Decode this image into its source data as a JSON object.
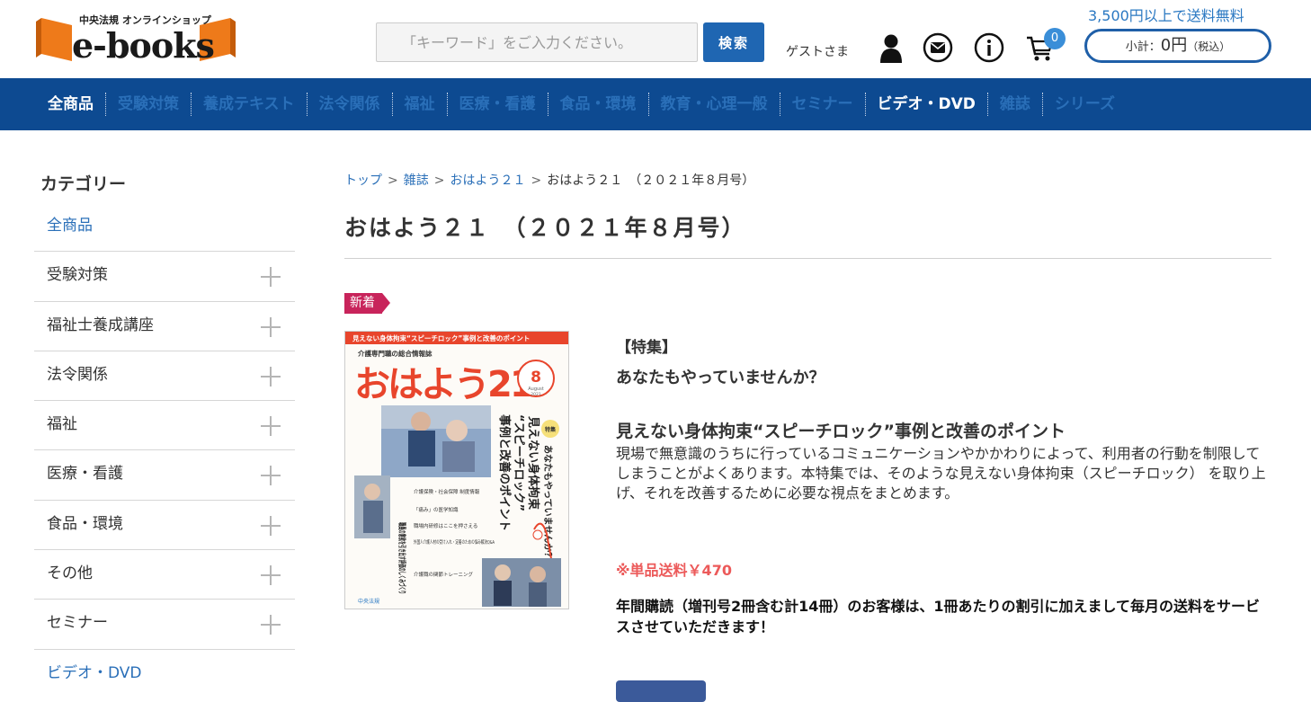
{
  "header": {
    "logo_sub": "中央法規 オンラインショップ",
    "logo_main": "e-books",
    "search_placeholder": "「キーワード」をご入力ください。",
    "search_button": "検索",
    "guest": "ゲストさま",
    "cart_count": "0",
    "free_shipping": "3,500円以上で送料無料",
    "subtotal_label": "小計：",
    "subtotal_amount": "0円",
    "subtotal_tax": "（税込）"
  },
  "nav": {
    "items": [
      "全商品",
      "受験対策",
      "養成テキスト",
      "法令関係",
      "福祉",
      "医療・看護",
      "食品・環境",
      "教育・心理一般",
      "セミナー",
      "ビデオ・DVD",
      "雑誌",
      "シリーズ"
    ]
  },
  "sidebar": {
    "title": "カテゴリー",
    "items": [
      "全商品",
      "受験対策",
      "福祉士養成講座",
      "法令関係",
      "福祉",
      "医療・看護",
      "食品・環境",
      "その他",
      "セミナー",
      "ビデオ・DVD"
    ]
  },
  "breadcrumb": [
    "トップ",
    "雑誌",
    "おはよう２１",
    "おはよう２１　（２０２１年８月号）"
  ],
  "product": {
    "title": "おはよう２１　（２０２１年８月号）",
    "new_tag": "新着",
    "feature_tag": "【特集】",
    "lead": "あなたもやっていませんか？",
    "headline": "見えない身体拘束“スピーチロック”事例と改善のポイント",
    "body": "現場で無意識のうちに行っているコミュニケーションやかかわりによって、利用者の行動を制限してしまうことがよくあります。本特集では、そのような見えない身体拘束（スピーチロック） を取り上げ、それを改善するために必要な視点をまとめます。",
    "shipping": "※単品送料￥470",
    "subscription": "年間購読（増刊号2冊含む計14冊）のお客様は、1冊あたりの割引に加えまして毎月の送料をサービスさせていただきます！"
  },
  "cover": {
    "top_banner": "見えない身体拘束“スピーチロック”事例と改善のポイント",
    "magazine_sub": "介護専門職の総合情報誌",
    "magazine_name": "おはよう21",
    "issue_number": "8",
    "issue_month": "August",
    "issue_year": "2021",
    "feature_badge": "特集",
    "question": "あなたもやっていませんか？",
    "headline_line1": "見えない身体拘束",
    "headline_line2": "“スピーチロック”",
    "headline_line3": "事例と改善のポイント",
    "side_text_1": "職員の意欲を引き出す評価のしくみづくり",
    "side_text_2": "介護保険・社会保障 制度情報",
    "side_text_3": "「痛み」の医学知識",
    "side_text_4": "職場内研修はここを押さえる",
    "side_text_5": "外国人介護人材の受け入れ・定着のための悩み解決Q&A",
    "side_text_6": "介護職の関節トレーニング",
    "publisher": "中央法規"
  },
  "colors": {
    "brand_blue": "#0d4a91",
    "accent_blue": "#1f66b2",
    "link_blue": "#2a6fb8",
    "new_tag": "#c8245b",
    "shipping_red": "#ec5a5a",
    "cover_red": "#e8452c",
    "logo_orange": "#ee7a1a"
  }
}
